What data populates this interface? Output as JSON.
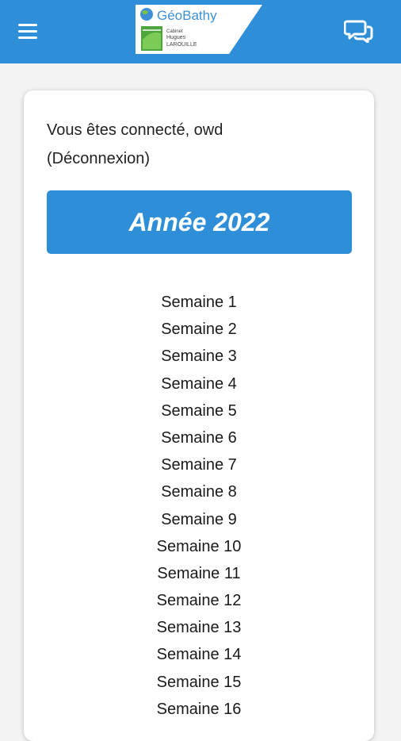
{
  "header": {
    "menu_icon": "hamburger-menu-icon",
    "chat_icon": "chat-bubbles-icon",
    "brand_color": "#2e8fd8",
    "logo": {
      "title": "GéoBathy",
      "subtitle_line1": "Cabinet",
      "subtitle_line2": "Hugues",
      "subtitle_line3": "LAROUILLE"
    }
  },
  "session": {
    "connected_text": "Vous êtes connecté, owd",
    "logout_label": "(Déconnexion)"
  },
  "year_banner": {
    "label": "Année 2022"
  },
  "weeks": [
    "Semaine 1",
    "Semaine 2",
    "Semaine 3",
    "Semaine 4",
    "Semaine 5",
    "Semaine 6",
    "Semaine 7",
    "Semaine 8",
    "Semaine 9",
    "Semaine 10",
    "Semaine 11",
    "Semaine 12",
    "Semaine 13",
    "Semaine 14",
    "Semaine 15",
    "Semaine 16"
  ]
}
